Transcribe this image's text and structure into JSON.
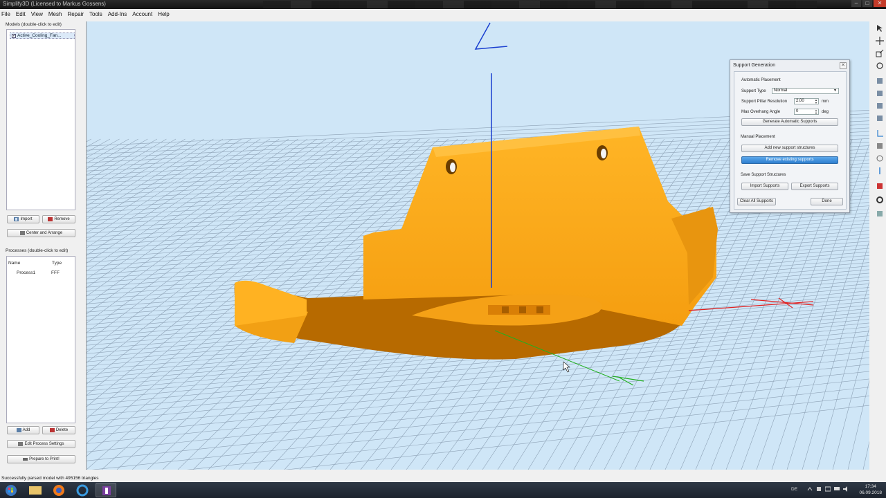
{
  "window": {
    "title": "Simplify3D (Licensed to Markus Gossens)",
    "buttons": {
      "minimize": "–",
      "maximize": "□",
      "close": "✕"
    }
  },
  "menu": [
    "File",
    "Edit",
    "View",
    "Mesh",
    "Repair",
    "Tools",
    "Add-Ins",
    "Account",
    "Help"
  ],
  "models": {
    "label": "Models (double-click to edit)",
    "items": [
      {
        "name": "Active_Cooling_Fan...",
        "checked": "✓"
      }
    ],
    "import_label": "Import",
    "remove_label": "Remove",
    "center_label": "Center and Arrange"
  },
  "processes": {
    "label": "Processes (double-click to edit)",
    "columns": [
      "Name",
      "Type"
    ],
    "rows": [
      {
        "name": "Process1",
        "type": "FFF"
      }
    ],
    "add_label": "Add",
    "delete_label": "Delete",
    "edit_label": "Edit Process Settings",
    "prepare_label": "Prepare to Print!"
  },
  "dialog": {
    "title": "Support Generation",
    "close": "✕",
    "automatic_header": "Automatic Placement",
    "support_type_label": "Support Type",
    "support_type_value": "Normal",
    "pillar_label": "Support Pillar Resolution",
    "pillar_value": "2,00",
    "pillar_unit": "mm",
    "overhang_label": "Max Overhang Angle",
    "overhang_value": "0",
    "overhang_unit": "deg",
    "generate_label": "Generate Automatic Supports",
    "manual_header": "Manual Placement",
    "add_new_label": "Add new support structures",
    "remove_existing_label": "Remove existing supports",
    "save_header": "Save Support Structures",
    "import_supports_label": "Import Supports",
    "export_supports_label": "Export Supports",
    "clear_label": "Clear All Supports",
    "done_label": "Done"
  },
  "status": {
    "text": "Successfully parsed model with 495156 triangles"
  },
  "taskbar": {
    "lang": "DE",
    "time": "17:34",
    "date": "06.09.2018"
  },
  "colors": {
    "model": "#ffae1c",
    "model_shadow": "#b76a00",
    "viewport_bg": "#cfe6f7",
    "grid": "#8ea2b6",
    "axis_z": "#1a3fd0",
    "axis_x": "#e02020",
    "axis_y": "#22b020",
    "accent": "#2f7fcf"
  },
  "icons": [
    "select-icon",
    "move-icon",
    "scale-icon",
    "rotate-icon",
    "view-cube-icon",
    "support-icon",
    "settings-icon"
  ]
}
